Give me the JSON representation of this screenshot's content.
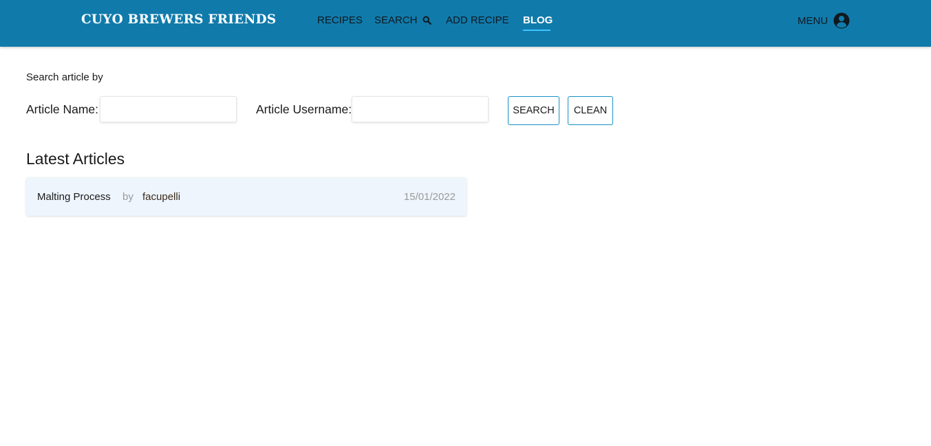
{
  "header": {
    "brand": "CUYO BREWERS FRIENDS",
    "nav": {
      "recipes": "RECIPES",
      "search": "SEARCH",
      "add_recipe": "ADD RECIPE",
      "blog": "BLOG"
    },
    "active_tab": "blog",
    "menu_label": "MENU",
    "icons": {
      "search": "search-icon",
      "account": "account-circle-icon"
    }
  },
  "search_form": {
    "caption": "Search article by",
    "article_name_label": "Article Name:",
    "article_name_value": "",
    "article_username_label": "Article Username:",
    "article_username_value": "",
    "search_button": "SEARCH",
    "clean_button": "CLEAN"
  },
  "latest": {
    "title": "Latest Articles",
    "articles": [
      {
        "name": "Malting Process",
        "by": "by",
        "username": "facupelli",
        "date": "15/01/2022"
      }
    ]
  },
  "colors": {
    "navbar": "#107bab",
    "nav_active": "#ffffff",
    "nav_underline": "#3ec4ff",
    "button_border": "#1890c8",
    "card_background": "#eef5fd"
  }
}
